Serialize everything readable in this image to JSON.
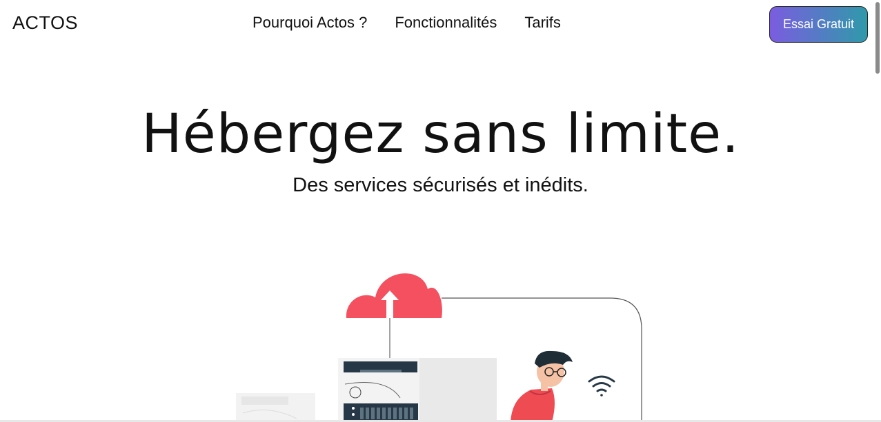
{
  "header": {
    "brand": "ACTOS",
    "nav": [
      {
        "label": "Pourquoi Actos ?"
      },
      {
        "label": "Fonctionnalités"
      },
      {
        "label": "Tarifs"
      }
    ],
    "cta_label": "Essai Gratuit"
  },
  "hero": {
    "title": "Hébergez sans limite.",
    "subtitle": "Des services sécurisés et inédits."
  },
  "colors": {
    "cta_gradient_start": "#7b5ce0",
    "cta_gradient_end": "#2f9aaa",
    "cloud": "#f4505f",
    "hoodie": "#ef4b53",
    "server_dark": "#263847"
  },
  "icons": [
    "cloud-upload-icon",
    "wifi-icon"
  ]
}
